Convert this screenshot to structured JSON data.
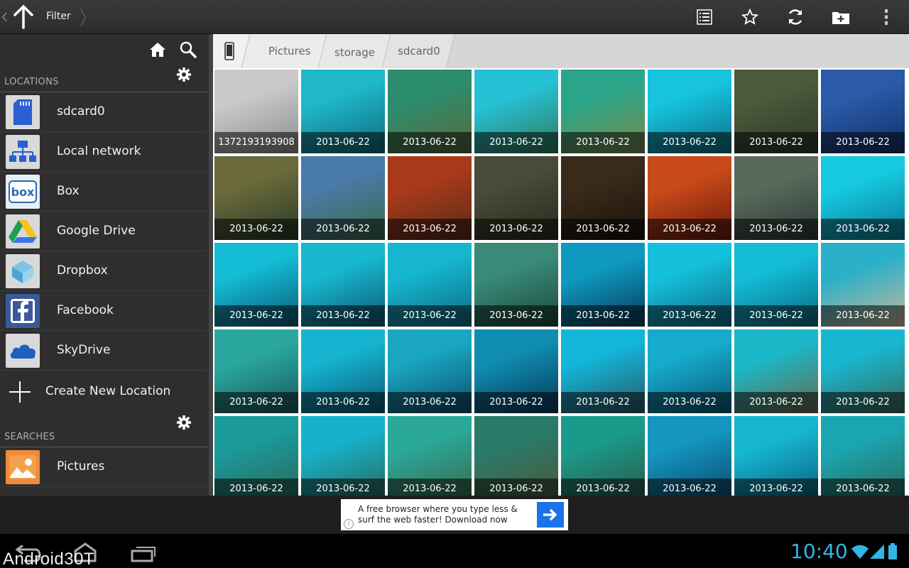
{
  "actionbar": {
    "title": "Filter",
    "icons": [
      "up-arrow-icon",
      "list-view-icon",
      "star-icon",
      "refresh-icon",
      "new-folder-icon",
      "overflow-menu-icon"
    ]
  },
  "sidebar": {
    "locations_header": "LOCATIONS",
    "locations": [
      {
        "label": "sdcard0",
        "icon": "sdcard-icon"
      },
      {
        "label": "Local network",
        "icon": "network-icon"
      },
      {
        "label": "Box",
        "icon": "box-icon"
      },
      {
        "label": "Google Drive",
        "icon": "google-drive-icon"
      },
      {
        "label": "Dropbox",
        "icon": "dropbox-icon"
      },
      {
        "label": "Facebook",
        "icon": "facebook-icon"
      },
      {
        "label": "SkyDrive",
        "icon": "skydrive-icon"
      }
    ],
    "create_label": "Create New Location",
    "searches_header": "SEARCHES",
    "searches": [
      {
        "label": "Pictures",
        "icon": "pictures-icon"
      }
    ]
  },
  "breadcrumb": {
    "items": [
      "Pictures",
      "storage",
      "sdcard0"
    ]
  },
  "grid": {
    "captions": [
      "1372193193908",
      "2013-06-22",
      "2013-06-22",
      "2013-06-22",
      "2013-06-22",
      "2013-06-22",
      "2013-06-22",
      "2013-06-22",
      "2013-06-22",
      "2013-06-22",
      "2013-06-22",
      "2013-06-22",
      "2013-06-22",
      "2013-06-22",
      "2013-06-22",
      "2013-06-22",
      "2013-06-22",
      "2013-06-22",
      "2013-06-22",
      "2013-06-22",
      "2013-06-22",
      "2013-06-22",
      "2013-06-22",
      "2013-06-22",
      "2013-06-22",
      "2013-06-22",
      "2013-06-22",
      "2013-06-22",
      "2013-06-22",
      "2013-06-22",
      "2013-06-22",
      "2013-06-22",
      "2013-06-22",
      "2013-06-22",
      "2013-06-22",
      "2013-06-22",
      "2013-06-22",
      "2013-06-22",
      "2013-06-22",
      "2013-06-22"
    ],
    "palettes": [
      [
        "#c9c9c9",
        "#8c8c8c"
      ],
      [
        "#1fb7c9",
        "#0e6a7c"
      ],
      [
        "#2c8c6e",
        "#5a6a3a"
      ],
      [
        "#27c1d6",
        "#2f7a5a"
      ],
      [
        "#2aa58a",
        "#7a8a4a"
      ],
      [
        "#17c3df",
        "#0b6f86"
      ],
      [
        "#4a5a3a",
        "#2a3a2a"
      ],
      [
        "#2a5aa8",
        "#12306a"
      ],
      [
        "#6a6a3a",
        "#2a3a2a"
      ],
      [
        "#4a7aa8",
        "#3a6a4a"
      ],
      [
        "#a83a1a",
        "#5a2a1a"
      ],
      [
        "#4a4a3a",
        "#2a2a1a"
      ],
      [
        "#3a2a1a",
        "#1a120a"
      ],
      [
        "#c84a1a",
        "#6a1a0a"
      ],
      [
        "#5a6a5a",
        "#2a3a3a"
      ],
      [
        "#16c8e0",
        "#0a7a96"
      ],
      [
        "#14bcd6",
        "#0a5a76"
      ],
      [
        "#18b8d0",
        "#0a5a72"
      ],
      [
        "#16b6d0",
        "#0c6a80"
      ],
      [
        "#3a8a7a",
        "#1a4a3a"
      ],
      [
        "#0e9ac0",
        "#063a5a"
      ],
      [
        "#16c0dc",
        "#0a6a86"
      ],
      [
        "#14bcd8",
        "#0a6a80"
      ],
      [
        "#2ab0c8",
        "#c8b89a"
      ],
      [
        "#2aa8a0",
        "#1a5a5a"
      ],
      [
        "#16b4d0",
        "#0a5a78"
      ],
      [
        "#1aa6c0",
        "#0a5070"
      ],
      [
        "#108cb0",
        "#063a5a"
      ],
      [
        "#12b6d8",
        "#2a5a6a"
      ],
      [
        "#16aacc",
        "#0a5a78"
      ],
      [
        "#1ab8c8",
        "#6a6a4a"
      ],
      [
        "#18b6d0",
        "#3a6a5a"
      ],
      [
        "#1a9a9a",
        "#2a6a5a"
      ],
      [
        "#16b2cc",
        "#2a6a5a"
      ],
      [
        "#2aa89a",
        "#3a6a4a"
      ],
      [
        "#2a7a6a",
        "#4a5a3a"
      ],
      [
        "#1a9a8a",
        "#2a5a4a"
      ],
      [
        "#1496c0",
        "#0a4a70"
      ],
      [
        "#16b6d0",
        "#0a6080"
      ],
      [
        "#1aa6b0",
        "#2a6a5a"
      ]
    ]
  },
  "ad": {
    "text": "A free browser where you type less & surf the web faster! Download now",
    "info": "i"
  },
  "statusbar": {
    "time": "10:40",
    "watermark": "Android30T"
  }
}
